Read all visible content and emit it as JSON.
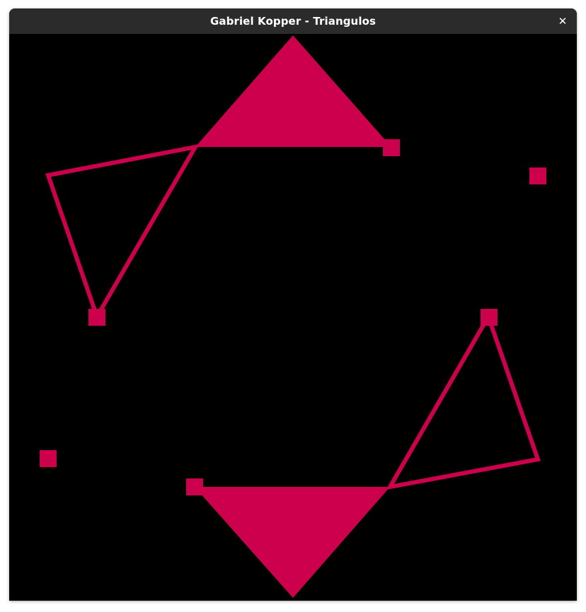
{
  "window": {
    "title": "Gabriel Kopper - Triangulos",
    "close_glyph": "✕"
  },
  "colors": {
    "titlebar": "#2b2b2b",
    "canvas_background": "#000000",
    "shape": "#cc004c"
  },
  "icons": {
    "close": "close-icon"
  }
}
